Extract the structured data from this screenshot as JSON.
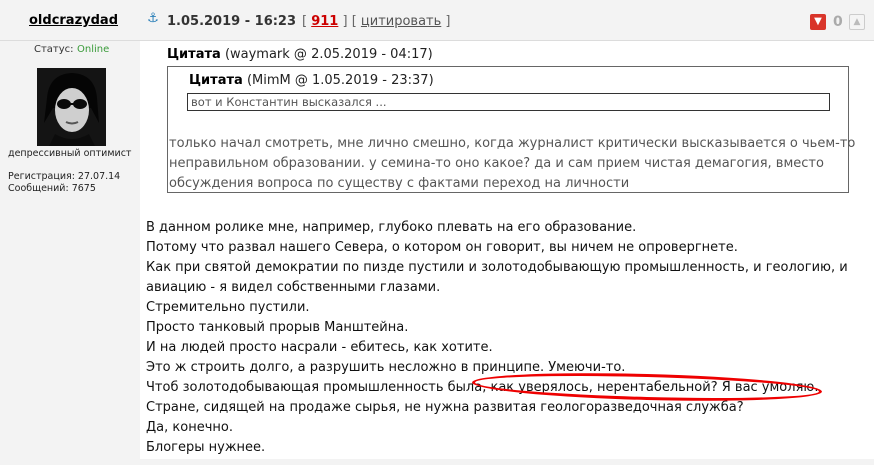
{
  "post": {
    "username": "oldcrazydad",
    "date": "1.05.2019 - 16:23",
    "number": "911",
    "quote_link": "цитировать",
    "votes": "0"
  },
  "user": {
    "status_label": "Статус:",
    "status_value": "Online",
    "title": "депрессивный оптимист",
    "registration": "Регистрация: 27.07.14",
    "messages": "Сообщений: 7675"
  },
  "quote_outer": {
    "label": "Цитата",
    "meta": "(waymark @ 2.05.2019 - 04:17)",
    "lines": [
      "только начал смотреть, мне лично смешно, когда журналист критически высказывается о чьем-то",
      "неправильном образовании. у семина-то оно какое? да и сам прием чистая демагогия, вместо",
      "обсуждения вопроса по существу с фактами переход на личности"
    ]
  },
  "quote_inner": {
    "label": "Цитата",
    "meta": "(MimM @ 1.05.2019 - 23:37)",
    "text": "вот и Константин высказался ..."
  },
  "body_lines": [
    "В данном ролике мне, например, глубоко плевать на его образование.",
    "Потому что развал нашего Севера, о котором он говорит, вы ничем не опровергнете.",
    "Как при святой демократии по пизде пустили и золотодобывающую промышленность, и геологию, и",
    "авиацию - я видел собственными глазами.",
    "Стремительно пустили.",
    "Просто танковый прорыв Манштейна.",
    "И на людей просто насрали - ебитесь, как хотите.",
    "Это ж строить долго, а разрушить несложно в принципе. Умеючи-то.",
    "Чтоб золотодобывающая промышленность была, как уверялось, нерентабельной? Я вас умоляю.",
    "Стране, сидящей на продаже сырья, не нужна развитая геологоразведочная служба?",
    "Да, конечно.",
    "Блогеры нужнее."
  ],
  "icons": {
    "anchor": "anchor-icon",
    "thumb_down": "thumb-down-icon",
    "thumb_up": "thumb-up-icon"
  }
}
